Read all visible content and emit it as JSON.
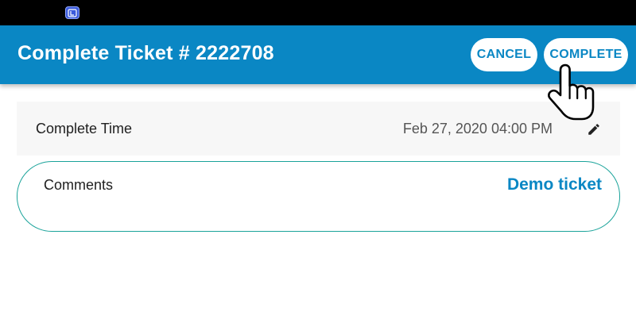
{
  "status_bar": {
    "app_icon": "launcher-app-icon"
  },
  "header": {
    "title": "Complete Ticket # 2222708",
    "cancel_label": "CANCEL",
    "complete_label": "COMPLETE"
  },
  "fields": {
    "complete_time": {
      "label": "Complete Time",
      "value": "Feb 27, 2020 04:00 PM",
      "edit_icon": "pencil-icon"
    },
    "comments": {
      "label": "Comments",
      "value": "Demo ticket"
    }
  },
  "colors": {
    "primary": "#0a87c4",
    "status_bar": "#000000",
    "card_border": "#1aa39a"
  },
  "cursor": {
    "icon": "hand-pointer-icon"
  }
}
